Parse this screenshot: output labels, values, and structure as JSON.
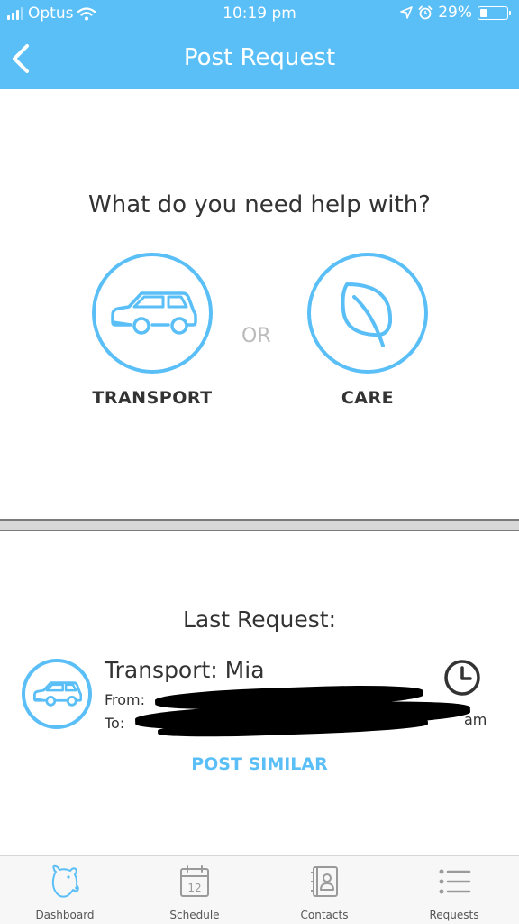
{
  "status_bar": {
    "carrier": "Optus",
    "time": "10:19 pm",
    "battery": "29%",
    "battery_level": 0.29
  },
  "nav": {
    "title": "Post Request",
    "back_icon": "chevron-left-icon"
  },
  "help": {
    "question": "What do you need help with?",
    "or_label": "OR",
    "options": [
      {
        "label": "TRANSPORT",
        "icon": "car-icon"
      },
      {
        "label": "CARE",
        "icon": "leaf-icon"
      }
    ]
  },
  "last_request": {
    "heading": "Last Request:",
    "title": "Transport: Mia",
    "from_label": "From:",
    "to_label": "To:",
    "time_fragment": "am",
    "action": "POST SIMILAR"
  },
  "tabs": [
    {
      "label": "Dashboard",
      "icon": "bear-icon"
    },
    {
      "label": "Schedule",
      "icon": "calendar-icon",
      "badge": "12"
    },
    {
      "label": "Contacts",
      "icon": "contacts-book-icon"
    },
    {
      "label": "Requests",
      "icon": "list-icon"
    }
  ],
  "colors": {
    "accent": "#5bbff7",
    "text": "#333333",
    "muted": "#bbbbbb"
  }
}
